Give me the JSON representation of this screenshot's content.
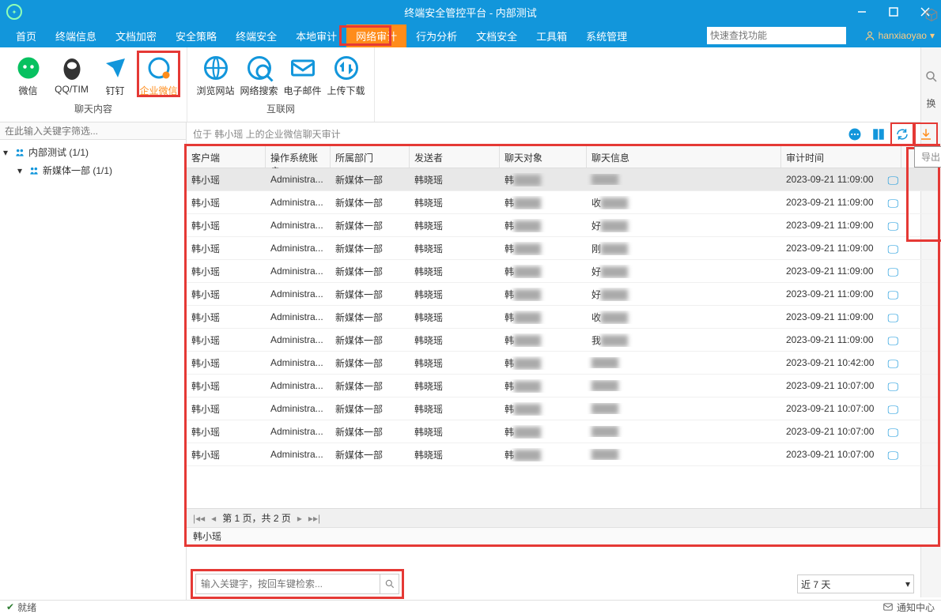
{
  "window": {
    "title": "终端安全管控平台 - 内部测试",
    "user": "hanxiaoyao"
  },
  "menu": {
    "items": [
      "首页",
      "终端信息",
      "文档加密",
      "安全策略",
      "终端安全",
      "本地审计",
      "网络审计",
      "行为分析",
      "文档安全",
      "工具箱",
      "系统管理"
    ],
    "active_index": 6,
    "search_placeholder": "快速查找功能"
  },
  "ribbon": {
    "groups": [
      {
        "label": "聊天内容",
        "items": [
          {
            "name": "wechat",
            "label": "微信",
            "color": "#07c160"
          },
          {
            "name": "qqtim",
            "label": "QQ/TIM",
            "color": "#333"
          },
          {
            "name": "dingtalk",
            "label": "钉钉",
            "color": "#1296db"
          },
          {
            "name": "wecom",
            "label": "企业微信",
            "color": "#ff8c1a",
            "highlighted": true,
            "selected": true
          }
        ]
      },
      {
        "label": "互联网",
        "items": [
          {
            "name": "browse",
            "label": "浏览网站",
            "color": "#1296db"
          },
          {
            "name": "websearch",
            "label": "网络搜索",
            "color": "#1296db"
          },
          {
            "name": "email",
            "label": "电子邮件",
            "color": "#1296db"
          },
          {
            "name": "updown",
            "label": "上传下载",
            "color": "#1296db"
          }
        ]
      }
    ]
  },
  "side": {
    "swap_label": "换"
  },
  "left": {
    "filter_placeholder": "在此输入关键字筛选...",
    "nodes": [
      {
        "label": "内部测试 (1/1)",
        "type": "org",
        "indent": 0
      },
      {
        "label": "新媒体一部 (1/1)",
        "type": "org",
        "indent": 1
      }
    ]
  },
  "content": {
    "crumb": "位于 韩小瑶 上的企业微信聊天审计",
    "export_tip": "导出",
    "columns": [
      "客户端",
      "操作系统账户",
      "所属部门",
      "发送者",
      "聊天对象",
      "聊天信息",
      "审计时间"
    ],
    "rows": [
      {
        "c": "韩小瑶",
        "o": "Administra...",
        "d": "新媒体一部",
        "s": "韩晓瑶",
        "t": "韩",
        "m": "",
        "a": "2023-09-21 11:09:00",
        "sel": true
      },
      {
        "c": "韩小瑶",
        "o": "Administra...",
        "d": "新媒体一部",
        "s": "韩晓瑶",
        "t": "韩",
        "m": "收",
        "a": "2023-09-21 11:09:00"
      },
      {
        "c": "韩小瑶",
        "o": "Administra...",
        "d": "新媒体一部",
        "s": "韩晓瑶",
        "t": "韩",
        "m": "好",
        "a": "2023-09-21 11:09:00"
      },
      {
        "c": "韩小瑶",
        "o": "Administra...",
        "d": "新媒体一部",
        "s": "韩晓瑶",
        "t": "韩",
        "m": "刚",
        "a": "2023-09-21 11:09:00"
      },
      {
        "c": "韩小瑶",
        "o": "Administra...",
        "d": "新媒体一部",
        "s": "韩晓瑶",
        "t": "韩",
        "m": "好",
        "a": "2023-09-21 11:09:00"
      },
      {
        "c": "韩小瑶",
        "o": "Administra...",
        "d": "新媒体一部",
        "s": "韩晓瑶",
        "t": "韩",
        "m": "好",
        "a": "2023-09-21 11:09:00"
      },
      {
        "c": "韩小瑶",
        "o": "Administra...",
        "d": "新媒体一部",
        "s": "韩晓瑶",
        "t": "韩",
        "m": "收",
        "a": "2023-09-21 11:09:00"
      },
      {
        "c": "韩小瑶",
        "o": "Administra...",
        "d": "新媒体一部",
        "s": "韩晓瑶",
        "t": "韩",
        "m": "我",
        "a": "2023-09-21 11:09:00"
      },
      {
        "c": "韩小瑶",
        "o": "Administra...",
        "d": "新媒体一部",
        "s": "韩晓瑶",
        "t": "韩",
        "m": "",
        "a": "2023-09-21 10:42:00"
      },
      {
        "c": "韩小瑶",
        "o": "Administra...",
        "d": "新媒体一部",
        "s": "韩晓瑶",
        "t": "韩",
        "m": "",
        "a": "2023-09-21 10:07:00"
      },
      {
        "c": "韩小瑶",
        "o": "Administra...",
        "d": "新媒体一部",
        "s": "韩晓瑶",
        "t": "韩",
        "m": "",
        "a": "2023-09-21 10:07:00"
      },
      {
        "c": "韩小瑶",
        "o": "Administra...",
        "d": "新媒体一部",
        "s": "韩晓瑶",
        "t": "韩",
        "m": "",
        "a": "2023-09-21 10:07:00"
      },
      {
        "c": "韩小瑶",
        "o": "Administra...",
        "d": "新媒体一部",
        "s": "韩晓瑶",
        "t": "韩",
        "m": "",
        "a": "2023-09-21 10:07:00"
      }
    ],
    "pager": "第 1 页，共 2 页",
    "detail_user": "韩小瑶",
    "kw_placeholder": "输入关键字，按回车键检索...",
    "time_range": "近 7 天"
  },
  "status": {
    "left": "就绪",
    "right": "通知中心"
  }
}
